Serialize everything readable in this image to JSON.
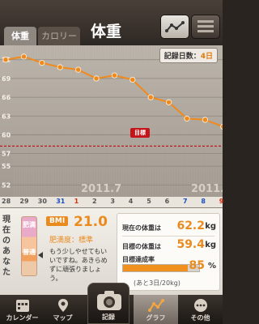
{
  "header": {
    "tabs": [
      {
        "label": "体重"
      },
      {
        "label": "カロリー"
      }
    ],
    "title": "体重"
  },
  "chart": {
    "records_label": "記録日数：",
    "records_count": "4日",
    "target_label": "目標",
    "month_labels": [
      "2011.7",
      "2011."
    ],
    "day_labels": [
      "28",
      "29",
      "30",
      "31",
      "1",
      "2",
      "3",
      "4",
      "5",
      "6",
      "7",
      "8",
      "9"
    ]
  },
  "chart_data": {
    "type": "line",
    "y_ticks": [
      72,
      69,
      66,
      63,
      60,
      57,
      55,
      52
    ],
    "ylim": [
      51,
      73
    ],
    "x_categories": [
      "28",
      "29",
      "30",
      "31",
      "1",
      "2",
      "3",
      "4",
      "5",
      "6",
      "7",
      "8",
      "9"
    ],
    "series": [
      {
        "values": [
          72,
          72.5,
          71.5,
          70.8,
          70.4,
          69,
          69.5,
          68.8,
          66,
          65.2,
          62.6,
          62.4,
          61.3
        ]
      }
    ],
    "target_line": 58.2
  },
  "info": {
    "side_label": "現在のあなた",
    "meter_labels": [
      "肥満",
      "普通"
    ],
    "bmi_tag": "BMI",
    "bmi_value": "21.0",
    "obesity": "肥満度：標準",
    "comment": "もう少しやせてもいいですね。あきらめずに頑張りましょう。"
  },
  "stats": {
    "current_label": "現在の体重は",
    "current_value": "62.2",
    "target_label": "目標の体重は",
    "target_value": "59.4",
    "unit": "kg",
    "achievement_label": "目標達成率",
    "achievement_value": "85",
    "achievement_unit": "%",
    "achievement_fraction": 0.85,
    "remaining": "(あと3日/20kg)"
  },
  "nav": {
    "items": [
      {
        "label": "カレンダー",
        "icon": "calendar-icon"
      },
      {
        "label": "マップ",
        "icon": "map-pin-icon"
      },
      {
        "label": "記録",
        "icon": "camera-icon"
      },
      {
        "label": "グラフ",
        "icon": "graph-icon"
      },
      {
        "label": "その他",
        "icon": "more-icon"
      }
    ]
  }
}
